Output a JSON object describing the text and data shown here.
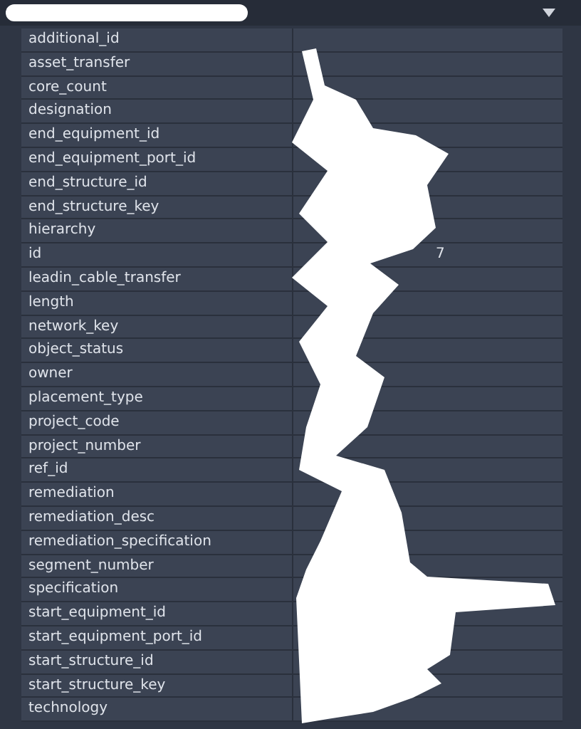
{
  "header": {
    "kind": "dropdown",
    "redacted": true
  },
  "properties": [
    {
      "name": "additional_id"
    },
    {
      "name": "asset_transfer"
    },
    {
      "name": "core_count"
    },
    {
      "name": "designation"
    },
    {
      "name": "end_equipment_id"
    },
    {
      "name": "end_equipment_port_id"
    },
    {
      "name": "end_structure_id"
    },
    {
      "name": "end_structure_key"
    },
    {
      "name": "hierarchy"
    },
    {
      "name": "id",
      "value": "7"
    },
    {
      "name": "leadin_cable_transfer"
    },
    {
      "name": "length"
    },
    {
      "name": "network_key"
    },
    {
      "name": "object_status"
    },
    {
      "name": "owner"
    },
    {
      "name": "placement_type"
    },
    {
      "name": "project_code"
    },
    {
      "name": "project_number"
    },
    {
      "name": "ref_id"
    },
    {
      "name": "remediation"
    },
    {
      "name": "remediation_desc"
    },
    {
      "name": "remediation_specification"
    },
    {
      "name": "segment_number"
    },
    {
      "name": "specification"
    },
    {
      "name": "start_equipment_id"
    },
    {
      "name": "start_equipment_port_id"
    },
    {
      "name": "start_structure_id"
    },
    {
      "name": "start_structure_key"
    },
    {
      "name": "technology"
    }
  ]
}
